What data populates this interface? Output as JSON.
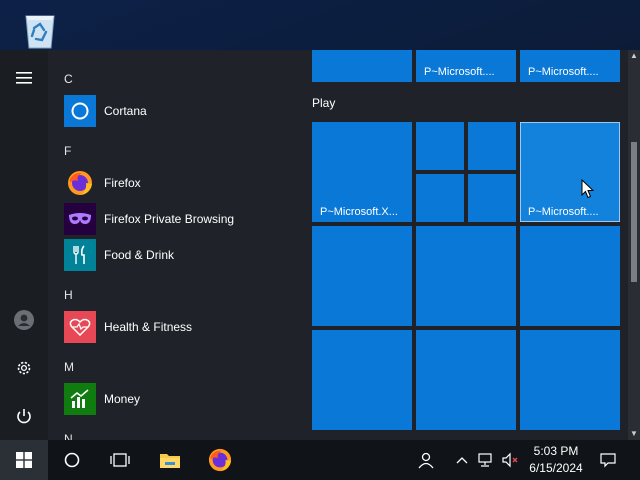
{
  "desktop": {
    "recycle_bin_icon": "recycle-bin-icon"
  },
  "rail": {
    "icons": [
      "hamburger-menu-icon",
      "user-avatar-icon",
      "settings-gear-icon",
      "power-icon"
    ]
  },
  "applist": {
    "letters": [
      "C",
      "F",
      "H",
      "M",
      "N"
    ],
    "apps": [
      {
        "label": "Cortana",
        "icon": "cortana-ring-icon",
        "color": "#0a78d7"
      },
      {
        "label": "Firefox",
        "icon": "firefox-icon",
        "color": "#ff7139"
      },
      {
        "label": "Firefox Private Browsing",
        "icon": "firefox-private-mask-icon",
        "color": "#25003e"
      },
      {
        "label": "Food & Drink",
        "icon": "fork-knife-icon",
        "color": "#008299"
      },
      {
        "label": "Health & Fitness",
        "icon": "heart-pulse-icon",
        "color": "#e74856"
      },
      {
        "label": "Money",
        "icon": "money-chart-icon",
        "color": "#107c10"
      }
    ]
  },
  "tiles": {
    "group_title": "Play",
    "labels": {
      "top_middle": "P~Microsoft....",
      "top_right": "P~Microsoft....",
      "play_large": "P~Microsoft.X...",
      "play_hover": "P~Microsoft...."
    },
    "accent": "#0a78d7"
  },
  "taskbar": {
    "time": "5:03 PM",
    "date": "6/15/2024",
    "icons": [
      "windows-logo-icon",
      "search-circle-icon",
      "task-view-icon",
      "file-explorer-icon",
      "firefox-icon",
      "people-icon",
      "chevron-up-icon",
      "network-icon",
      "volume-muted-icon",
      "notification-icon"
    ]
  }
}
